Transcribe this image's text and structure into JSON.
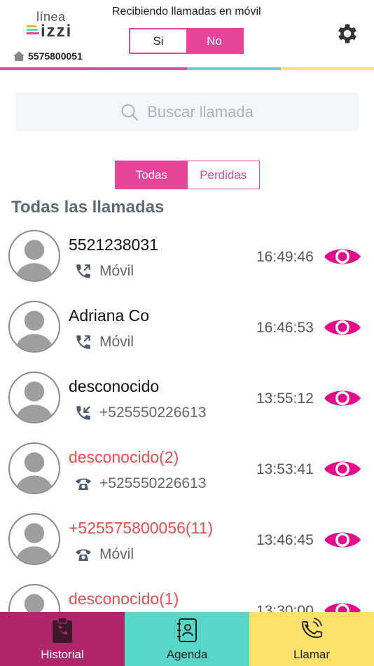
{
  "header": {
    "logo_top": "línea",
    "logo_bottom": "izzi",
    "phone_number": "5575800051",
    "receiving_label": "Recibiendo llamadas en móvil",
    "toggle_si": "Si",
    "toggle_no": "No",
    "toggle_selected": "No"
  },
  "colors": {
    "accent": "#e8449a",
    "brand_bar": [
      "#e8449a",
      "#d94f9f",
      "#58d6c8",
      "#fde16b"
    ],
    "missed": "#ee4c4c",
    "historial_bg": "#b0266b",
    "agenda_bg": "#58d6c8",
    "llamar_bg": "#fde16b"
  },
  "search": {
    "placeholder": "Buscar llamada"
  },
  "filter": {
    "todas": "Todas",
    "perdidas": "Perdidas",
    "selected": "Todas"
  },
  "section_title": "Todas las llamadas",
  "calls": [
    {
      "name": "5521238031",
      "detail": "Móvil",
      "time": "16:49:46",
      "missed": false,
      "type_icon": "outgoing-call-icon"
    },
    {
      "name": "Adriana Co",
      "detail": "Móvil",
      "time": "16:46:53",
      "missed": false,
      "type_icon": "outgoing-call-icon"
    },
    {
      "name": "desconocido",
      "detail": "+525550226613",
      "time": "13:55:12",
      "missed": false,
      "type_icon": "incoming-call-icon"
    },
    {
      "name": "desconocido(2)",
      "detail": "+525550226613",
      "time": "13:53:41",
      "missed": true,
      "type_icon": "missed-call-icon"
    },
    {
      "name": "+525575800056(11)",
      "detail": "Móvil",
      "time": "13:46:45",
      "missed": true,
      "type_icon": "missed-call-icon"
    },
    {
      "name": "desconocido(1)",
      "detail": "",
      "time": "13:30:00",
      "missed": true,
      "type_icon": "missed-call-icon"
    }
  ],
  "bottom_nav": {
    "historial": "Historial",
    "agenda": "Agenda",
    "llamar": "Llamar"
  }
}
